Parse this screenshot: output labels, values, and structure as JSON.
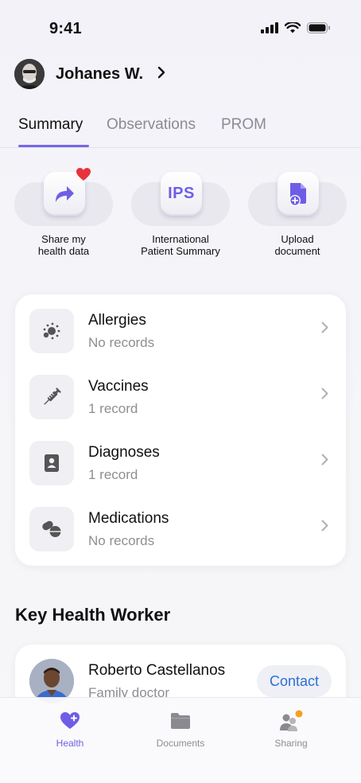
{
  "status_bar": {
    "time": "9:41"
  },
  "profile": {
    "name": "Johanes W.",
    "chevron": "›"
  },
  "tabs": [
    {
      "label": "Summary",
      "active": true
    },
    {
      "label": "Observations",
      "active": false
    },
    {
      "label": "PROM",
      "active": false
    }
  ],
  "quick_actions": [
    {
      "label_line1": "Share my",
      "label_line2": "health data",
      "icon": "share-arrow-icon"
    },
    {
      "label_line1": "International",
      "label_line2": "Patient Summary",
      "icon": "ips-icon",
      "icon_text": "IPS"
    },
    {
      "label_line1": "Upload",
      "label_line2": "document",
      "icon": "upload-document-icon"
    }
  ],
  "records": [
    {
      "title": "Allergies",
      "subtitle": "No records",
      "icon": "allergy-icon"
    },
    {
      "title": "Vaccines",
      "subtitle": "1 record",
      "icon": "syringe-icon"
    },
    {
      "title": "Diagnoses",
      "subtitle": "1 record",
      "icon": "diagnosis-icon"
    },
    {
      "title": "Medications",
      "subtitle": "No records",
      "icon": "pill-icon"
    }
  ],
  "key_health_worker": {
    "section_title": "Key Health Worker",
    "name": "Roberto Castellanos",
    "role": "Family doctor",
    "contact_label": "Contact"
  },
  "tab_bar": [
    {
      "label": "Health",
      "active": true,
      "icon": "health-heart-icon"
    },
    {
      "label": "Documents",
      "active": false,
      "icon": "folder-icon"
    },
    {
      "label": "Sharing",
      "active": false,
      "icon": "sharing-people-icon"
    }
  ],
  "colors": {
    "accent": "#6e5ee6",
    "link": "#2f6fd6",
    "badge": "#f5a021",
    "heart": "#e8323c"
  }
}
